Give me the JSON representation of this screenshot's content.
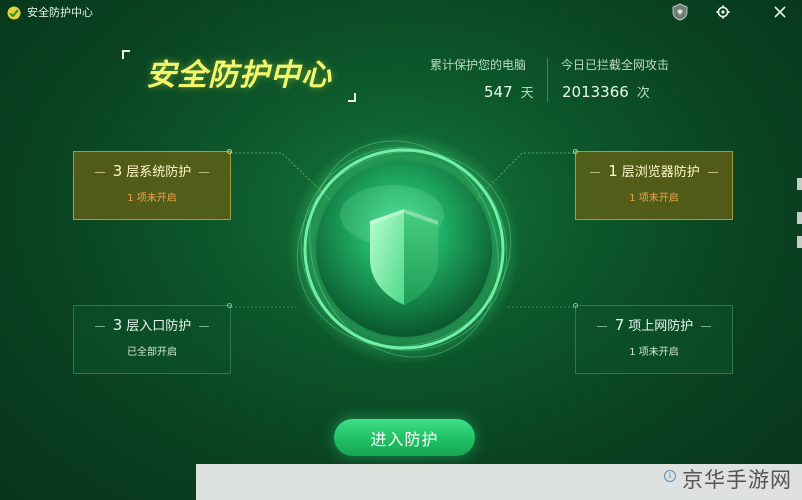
{
  "window": {
    "title": "安全防护中心",
    "controls": [
      {
        "name": "badge-icon"
      },
      {
        "name": "gear-icon"
      },
      {
        "name": "close-icon"
      }
    ]
  },
  "hero": {
    "title": "安全防护中心"
  },
  "stats": {
    "protected": {
      "label": "累计保护您的电脑",
      "value": "547",
      "unit": "天"
    },
    "blocked": {
      "label": "今日已拦截全网攻击",
      "value": "2013366",
      "unit": "次"
    }
  },
  "cards": {
    "system": {
      "count": "3",
      "title": "层系统防护",
      "status": "1 项未开启",
      "state": "warning"
    },
    "browser": {
      "count": "1",
      "title": "层浏览器防护",
      "status": "1 项未开启",
      "state": "warning"
    },
    "entry": {
      "count": "3",
      "title": "层入口防护",
      "status": "已全部开启",
      "state": "ok"
    },
    "internet": {
      "count": "7",
      "title": "项上网防护",
      "status": "1 项未开启",
      "state": "ok"
    }
  },
  "action": {
    "enter_label": "进入防护"
  },
  "watermark": {
    "text": "京华手游网"
  },
  "colors": {
    "background": "#0d5a2c",
    "hero_title": "#f2f56d",
    "warning_card": "#656015",
    "warning_text": "#f0a34c",
    "button": "#20bf63"
  }
}
